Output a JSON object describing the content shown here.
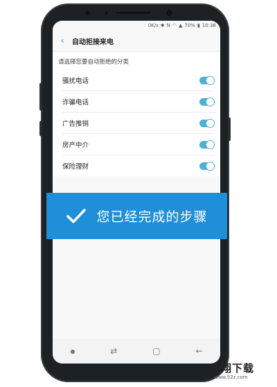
{
  "status_bar": {
    "network_speed": "0K/s",
    "battery": "70%",
    "time": "10:36"
  },
  "header": {
    "back_icon": "chevron-left-icon",
    "title": "自动拒接来电"
  },
  "settings": {
    "subtitle": "请选择您要自动拒绝的分类",
    "items": [
      {
        "label": "骚扰电话",
        "enabled": true
      },
      {
        "label": "诈骗电话",
        "enabled": true
      },
      {
        "label": "广告推销",
        "enabled": true
      },
      {
        "label": "房产中介",
        "enabled": true
      },
      {
        "label": "保险理财",
        "enabled": true
      }
    ],
    "toggle_color": "#4fb0d4"
  },
  "banner": {
    "icon": "check-icon",
    "label": "您已经完成的步骤",
    "color": "#1e8fd8"
  },
  "watermark": {
    "brand": "飞翔下载",
    "url": "www.52z.com"
  }
}
